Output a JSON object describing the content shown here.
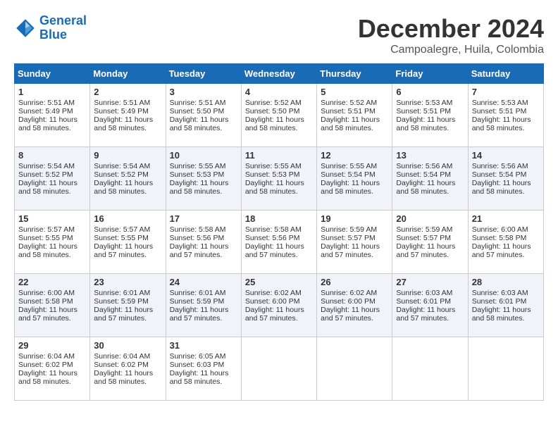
{
  "header": {
    "logo_line1": "General",
    "logo_line2": "Blue",
    "month": "December 2024",
    "location": "Campoalegre, Huila, Colombia"
  },
  "columns": [
    "Sunday",
    "Monday",
    "Tuesday",
    "Wednesday",
    "Thursday",
    "Friday",
    "Saturday"
  ],
  "weeks": [
    [
      {
        "day": "1",
        "rise": "5:51 AM",
        "set": "5:49 PM",
        "daylight": "11 hours and 58 minutes"
      },
      {
        "day": "2",
        "rise": "5:51 AM",
        "set": "5:49 PM",
        "daylight": "11 hours and 58 minutes"
      },
      {
        "day": "3",
        "rise": "5:51 AM",
        "set": "5:50 PM",
        "daylight": "11 hours and 58 minutes"
      },
      {
        "day": "4",
        "rise": "5:52 AM",
        "set": "5:50 PM",
        "daylight": "11 hours and 58 minutes"
      },
      {
        "day": "5",
        "rise": "5:52 AM",
        "set": "5:51 PM",
        "daylight": "11 hours and 58 minutes"
      },
      {
        "day": "6",
        "rise": "5:53 AM",
        "set": "5:51 PM",
        "daylight": "11 hours and 58 minutes"
      },
      {
        "day": "7",
        "rise": "5:53 AM",
        "set": "5:51 PM",
        "daylight": "11 hours and 58 minutes"
      }
    ],
    [
      {
        "day": "8",
        "rise": "5:54 AM",
        "set": "5:52 PM",
        "daylight": "11 hours and 58 minutes"
      },
      {
        "day": "9",
        "rise": "5:54 AM",
        "set": "5:52 PM",
        "daylight": "11 hours and 58 minutes"
      },
      {
        "day": "10",
        "rise": "5:55 AM",
        "set": "5:53 PM",
        "daylight": "11 hours and 58 minutes"
      },
      {
        "day": "11",
        "rise": "5:55 AM",
        "set": "5:53 PM",
        "daylight": "11 hours and 58 minutes"
      },
      {
        "day": "12",
        "rise": "5:55 AM",
        "set": "5:54 PM",
        "daylight": "11 hours and 58 minutes"
      },
      {
        "day": "13",
        "rise": "5:56 AM",
        "set": "5:54 PM",
        "daylight": "11 hours and 58 minutes"
      },
      {
        "day": "14",
        "rise": "5:56 AM",
        "set": "5:54 PM",
        "daylight": "11 hours and 58 minutes"
      }
    ],
    [
      {
        "day": "15",
        "rise": "5:57 AM",
        "set": "5:55 PM",
        "daylight": "11 hours and 58 minutes"
      },
      {
        "day": "16",
        "rise": "5:57 AM",
        "set": "5:55 PM",
        "daylight": "11 hours and 57 minutes"
      },
      {
        "day": "17",
        "rise": "5:58 AM",
        "set": "5:56 PM",
        "daylight": "11 hours and 57 minutes"
      },
      {
        "day": "18",
        "rise": "5:58 AM",
        "set": "5:56 PM",
        "daylight": "11 hours and 57 minutes"
      },
      {
        "day": "19",
        "rise": "5:59 AM",
        "set": "5:57 PM",
        "daylight": "11 hours and 57 minutes"
      },
      {
        "day": "20",
        "rise": "5:59 AM",
        "set": "5:57 PM",
        "daylight": "11 hours and 57 minutes"
      },
      {
        "day": "21",
        "rise": "6:00 AM",
        "set": "5:58 PM",
        "daylight": "11 hours and 57 minutes"
      }
    ],
    [
      {
        "day": "22",
        "rise": "6:00 AM",
        "set": "5:58 PM",
        "daylight": "11 hours and 57 minutes"
      },
      {
        "day": "23",
        "rise": "6:01 AM",
        "set": "5:59 PM",
        "daylight": "11 hours and 57 minutes"
      },
      {
        "day": "24",
        "rise": "6:01 AM",
        "set": "5:59 PM",
        "daylight": "11 hours and 57 minutes"
      },
      {
        "day": "25",
        "rise": "6:02 AM",
        "set": "6:00 PM",
        "daylight": "11 hours and 57 minutes"
      },
      {
        "day": "26",
        "rise": "6:02 AM",
        "set": "6:00 PM",
        "daylight": "11 hours and 57 minutes"
      },
      {
        "day": "27",
        "rise": "6:03 AM",
        "set": "6:01 PM",
        "daylight": "11 hours and 57 minutes"
      },
      {
        "day": "28",
        "rise": "6:03 AM",
        "set": "6:01 PM",
        "daylight": "11 hours and 58 minutes"
      }
    ],
    [
      {
        "day": "29",
        "rise": "6:04 AM",
        "set": "6:02 PM",
        "daylight": "11 hours and 58 minutes"
      },
      {
        "day": "30",
        "rise": "6:04 AM",
        "set": "6:02 PM",
        "daylight": "11 hours and 58 minutes"
      },
      {
        "day": "31",
        "rise": "6:05 AM",
        "set": "6:03 PM",
        "daylight": "11 hours and 58 minutes"
      },
      null,
      null,
      null,
      null
    ]
  ]
}
